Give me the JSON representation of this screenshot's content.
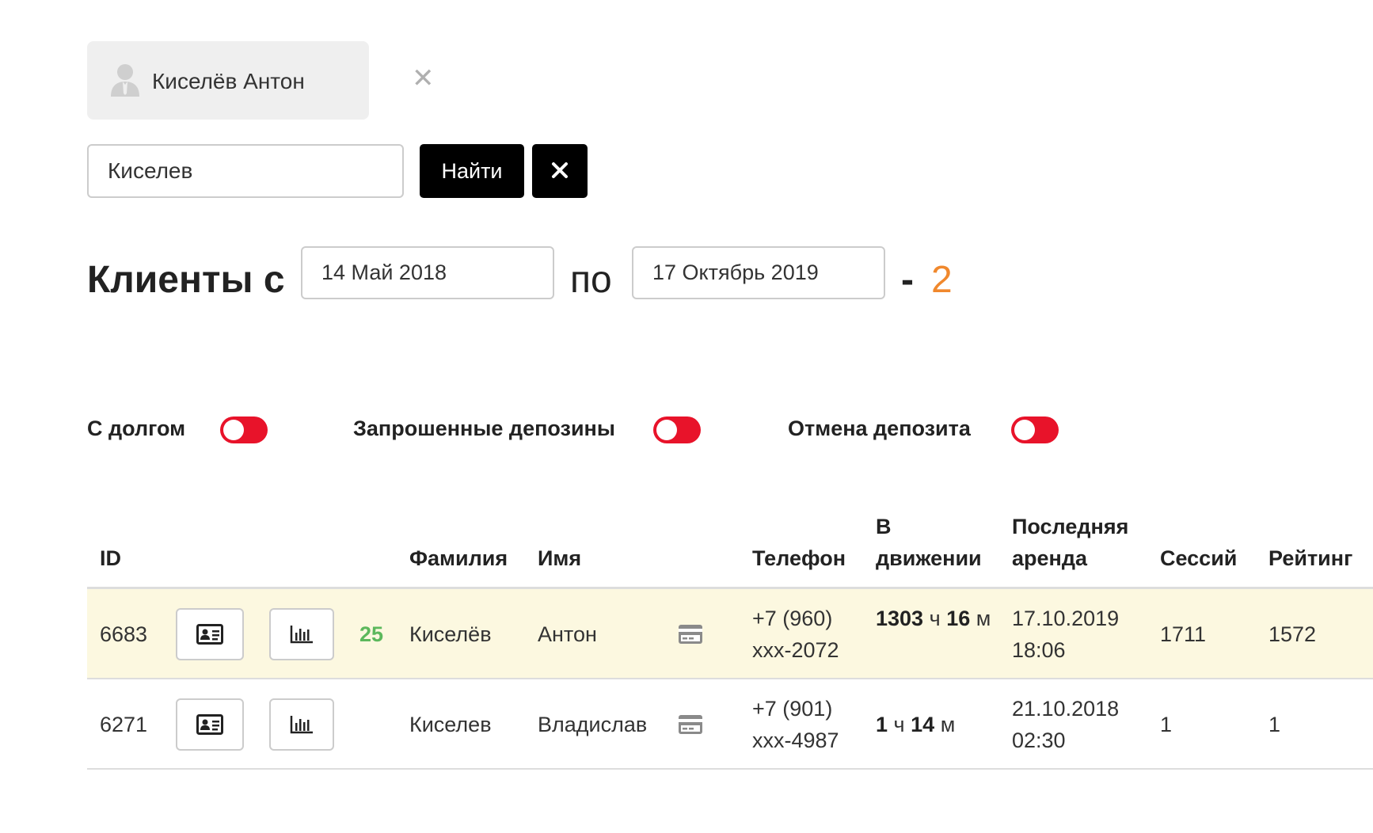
{
  "selected_client": {
    "name": "Киселёв Антон",
    "close_icon": "close-icon",
    "avatar_icon": "user-icon"
  },
  "search": {
    "value": "Киселев",
    "find_label": "Найти",
    "clear_icon": "close-icon"
  },
  "period": {
    "title_from": "Клиенты с",
    "date_from": "14 Май 2018",
    "title_to": "по",
    "date_to": "17 Октябрь 2019",
    "dash": "-",
    "count": "2",
    "count_color": "#f0882d"
  },
  "filters": [
    {
      "label": "С долгом",
      "on": false
    },
    {
      "label": "Запрошенные депозины",
      "on": false
    },
    {
      "label": "Отмена депозита",
      "on": false
    }
  ],
  "toggle_color": "#e8132a",
  "table": {
    "headers": {
      "id": "ID",
      "surname": "Фамилия",
      "name": "Имя",
      "phone": "Телефон",
      "moving_line1": "В",
      "moving_line2": "движении",
      "last_rent_line1": "Последняя",
      "last_rent_line2": "аренда",
      "sessions": "Сессий",
      "rating": "Рейтинг"
    },
    "rows": [
      {
        "id": "6683",
        "badge": "25",
        "surname": "Киселёв",
        "name": "Антон",
        "phone_line1": "+7 (960)",
        "phone_line2": "xxx-2072",
        "moving_hours": "1303",
        "moving_h_unit": "ч",
        "moving_minutes": "16",
        "moving_m_unit": "м",
        "last_rent_date": "17.10.2019",
        "last_rent_time": "18:06",
        "sessions": "1711",
        "rating": "1572"
      },
      {
        "id": "6271",
        "badge": "",
        "surname": "Киселев",
        "name": "Владислав",
        "phone_line1": "+7 (901)",
        "phone_line2": "xxx-4987",
        "moving_hours": "1",
        "moving_h_unit": "ч",
        "moving_minutes": "14",
        "moving_m_unit": "м",
        "last_rent_date": "21.10.2018",
        "last_rent_time": "02:30",
        "sessions": "1",
        "rating": "1"
      }
    ],
    "highlight_color": "#fcf8e0",
    "badge_color": "#5cb85c"
  }
}
